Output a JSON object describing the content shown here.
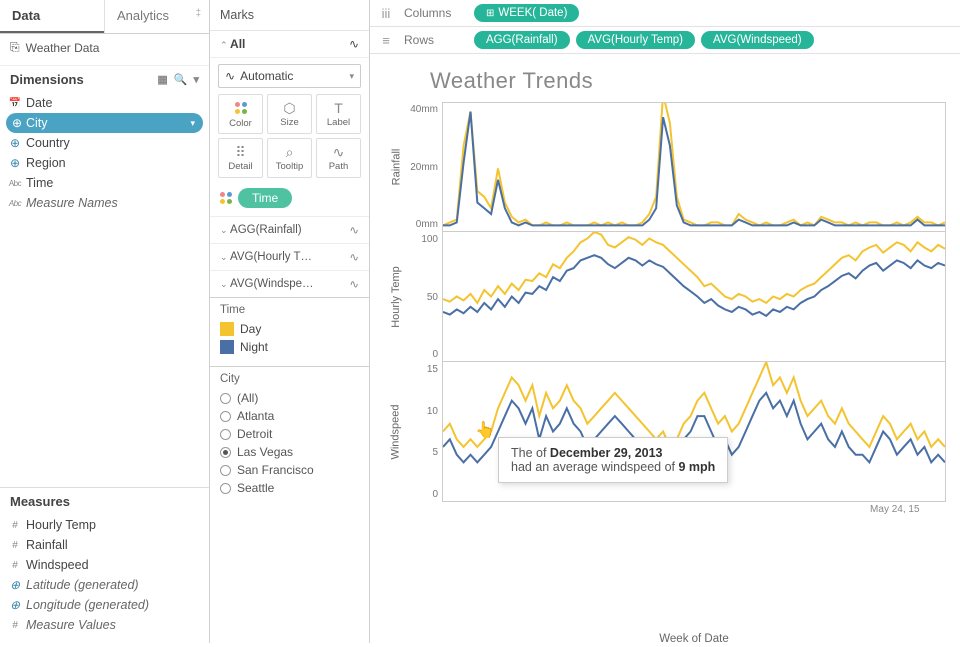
{
  "tabs": {
    "data": "Data",
    "analytics": "Analytics"
  },
  "datasource": {
    "name": "Weather Data"
  },
  "dimensions": {
    "title": "Dimensions",
    "items": [
      {
        "name": "Date",
        "kind": "date"
      },
      {
        "name": "City",
        "kind": "globe",
        "selected": true
      },
      {
        "name": "Country",
        "kind": "globe"
      },
      {
        "name": "Region",
        "kind": "globe"
      },
      {
        "name": "Time",
        "kind": "abc"
      },
      {
        "name": "Measure Names",
        "kind": "abc",
        "italic": true
      }
    ]
  },
  "measures": {
    "title": "Measures",
    "items": [
      {
        "name": "Hourly Temp",
        "kind": "hash"
      },
      {
        "name": "Rainfall",
        "kind": "hash"
      },
      {
        "name": "Windspeed",
        "kind": "hash"
      },
      {
        "name": "Latitude (generated)",
        "kind": "globe",
        "italic": true
      },
      {
        "name": "Longitude (generated)",
        "kind": "globe",
        "italic": true
      },
      {
        "name": "Measure Values",
        "kind": "hash",
        "italic": true
      }
    ]
  },
  "marks": {
    "title": "Marks",
    "all": "All",
    "type": "Automatic",
    "cells": [
      {
        "label": "Color",
        "icon": "dots"
      },
      {
        "label": "Size",
        "icon": "⬡"
      },
      {
        "label": "Label",
        "icon": "T"
      },
      {
        "label": "Detail",
        "icon": "⠿"
      },
      {
        "label": "Tooltip",
        "icon": "⌕"
      },
      {
        "label": "Path",
        "icon": "∿"
      }
    ],
    "pill": "Time",
    "measure_cards": [
      "AGG(Rainfall)",
      "AVG(Hourly T…",
      "AVG(Windspe…"
    ]
  },
  "legend_time": {
    "title": "Time",
    "items": [
      {
        "label": "Day",
        "color": "#f4c430"
      },
      {
        "label": "Night",
        "color": "#4a6fa5"
      }
    ]
  },
  "filter_city": {
    "title": "City",
    "items": [
      {
        "label": "(All)",
        "checked": false
      },
      {
        "label": "Atlanta",
        "checked": false
      },
      {
        "label": "Detroit",
        "checked": false
      },
      {
        "label": "Las Vegas",
        "checked": true
      },
      {
        "label": "San Francisco",
        "checked": false
      },
      {
        "label": "Seattle",
        "checked": false
      }
    ]
  },
  "shelves": {
    "columns_label": "Columns",
    "rows_label": "Rows",
    "columns": [
      "WEEK( Date)"
    ],
    "rows": [
      "AGG(Rainfall)",
      "AVG(Hourly Temp)",
      "AVG(Windspeed)"
    ]
  },
  "viz_title": "Weather Trends",
  "x_axis_label": "Week of Date",
  "x_tick_label": "May 24, 15",
  "colors": {
    "day": "#f4c430",
    "night": "#4a6fa5"
  },
  "tooltip": {
    "line1_pre": "The  of ",
    "line1_bold": "December 29, 2013",
    "line2_pre": "had an average windspeed of ",
    "line2_bold": "9 mph"
  },
  "chart_data": [
    {
      "type": "line",
      "title": "Rainfall",
      "ylabel": "Rainfall",
      "ylim": [
        0,
        45
      ],
      "yticks": [
        "0mm",
        "20mm",
        "40mm"
      ],
      "series": [
        {
          "name": "Day",
          "color": "#f4c430",
          "values": [
            2,
            3,
            4,
            30,
            42,
            14,
            12,
            8,
            22,
            10,
            5,
            3,
            4,
            2,
            2,
            3,
            2,
            2,
            3,
            2,
            2,
            2,
            3,
            2,
            3,
            2,
            3,
            2,
            2,
            3,
            6,
            12,
            48,
            38,
            12,
            4,
            3,
            2,
            2,
            3,
            3,
            2,
            2,
            6,
            4,
            3,
            2,
            3,
            2,
            2,
            3,
            4,
            2,
            3,
            2,
            5,
            4,
            3,
            3,
            2,
            3,
            2,
            3,
            3,
            2,
            2,
            3,
            2,
            3,
            5,
            3,
            3,
            2,
            3
          ]
        },
        {
          "name": "Night",
          "color": "#4a6fa5",
          "values": [
            2,
            2,
            3,
            24,
            42,
            10,
            8,
            6,
            18,
            8,
            3,
            2,
            3,
            2,
            2,
            2,
            2,
            2,
            2,
            2,
            2,
            2,
            2,
            2,
            2,
            2,
            2,
            2,
            2,
            2,
            4,
            8,
            40,
            30,
            9,
            3,
            2,
            2,
            2,
            2,
            2,
            2,
            2,
            4,
            3,
            2,
            2,
            2,
            2,
            2,
            2,
            3,
            2,
            2,
            2,
            4,
            3,
            2,
            2,
            2,
            2,
            2,
            2,
            2,
            2,
            2,
            2,
            2,
            2,
            4,
            2,
            2,
            2,
            2
          ]
        }
      ]
    },
    {
      "type": "line",
      "title": "Hourly Temp",
      "ylabel": "Hourly Temp",
      "ylim": [
        0,
        100
      ],
      "yticks": [
        "0",
        "50",
        "100"
      ],
      "series": [
        {
          "name": "Day",
          "color": "#f4c430",
          "values": [
            48,
            46,
            50,
            47,
            52,
            45,
            55,
            50,
            58,
            52,
            60,
            55,
            63,
            62,
            68,
            65,
            75,
            72,
            80,
            85,
            92,
            95,
            100,
            98,
            90,
            88,
            92,
            96,
            94,
            90,
            95,
            92,
            90,
            85,
            80,
            75,
            70,
            65,
            58,
            60,
            55,
            50,
            48,
            52,
            50,
            46,
            48,
            45,
            50,
            48,
            52,
            50,
            55,
            58,
            60,
            65,
            70,
            75,
            80,
            82,
            78,
            85,
            88,
            90,
            84,
            88,
            92,
            90,
            85,
            92,
            88,
            85,
            90,
            87
          ]
        },
        {
          "name": "Night",
          "color": "#4a6fa5",
          "values": [
            38,
            36,
            40,
            37,
            42,
            38,
            45,
            40,
            48,
            42,
            50,
            45,
            53,
            52,
            58,
            55,
            65,
            62,
            70,
            72,
            78,
            80,
            82,
            80,
            75,
            72,
            76,
            80,
            78,
            74,
            78,
            75,
            73,
            68,
            63,
            58,
            54,
            50,
            45,
            48,
            43,
            40,
            38,
            42,
            40,
            36,
            38,
            35,
            40,
            38,
            42,
            40,
            45,
            48,
            50,
            55,
            58,
            62,
            66,
            68,
            64,
            70,
            74,
            76,
            70,
            74,
            78,
            76,
            72,
            78,
            74,
            72,
            76,
            74
          ]
        }
      ]
    },
    {
      "type": "line",
      "title": "Windspeed",
      "ylabel": "Windspeed",
      "ylim": [
        0,
        18
      ],
      "yticks": [
        "0",
        "5",
        "10",
        "15"
      ],
      "series": [
        {
          "name": "Day",
          "color": "#f4c430",
          "values": [
            9,
            10,
            8,
            7,
            8,
            7,
            8,
            9,
            12,
            14,
            16,
            15,
            13,
            15,
            11,
            14,
            12,
            13,
            15,
            13,
            12,
            10,
            11,
            12,
            13,
            14,
            13,
            12,
            11,
            10,
            9,
            8,
            9,
            7,
            8,
            10,
            11,
            13,
            14,
            12,
            10,
            11,
            9,
            10,
            12,
            14,
            16,
            18,
            15,
            16,
            14,
            16,
            13,
            11,
            12,
            13,
            11,
            10,
            12,
            10,
            9,
            8,
            7,
            9,
            11,
            10,
            8,
            9,
            10,
            8,
            9,
            7,
            8,
            7
          ]
        },
        {
          "name": "Night",
          "color": "#4a6fa5",
          "values": [
            7,
            8,
            6,
            5,
            6,
            5,
            6,
            7,
            9,
            11,
            13,
            12,
            10,
            12,
            8,
            11,
            9,
            10,
            12,
            10,
            9,
            7,
            8,
            9,
            10,
            11,
            10,
            9,
            8,
            7,
            7,
            6,
            7,
            5,
            6,
            8,
            9,
            11,
            11,
            9,
            7,
            8,
            6,
            7,
            9,
            11,
            13,
            14,
            12,
            13,
            11,
            13,
            10,
            8,
            9,
            10,
            8,
            7,
            9,
            7,
            6,
            6,
            5,
            7,
            9,
            8,
            6,
            7,
            8,
            6,
            7,
            5,
            6,
            5
          ]
        }
      ]
    }
  ]
}
